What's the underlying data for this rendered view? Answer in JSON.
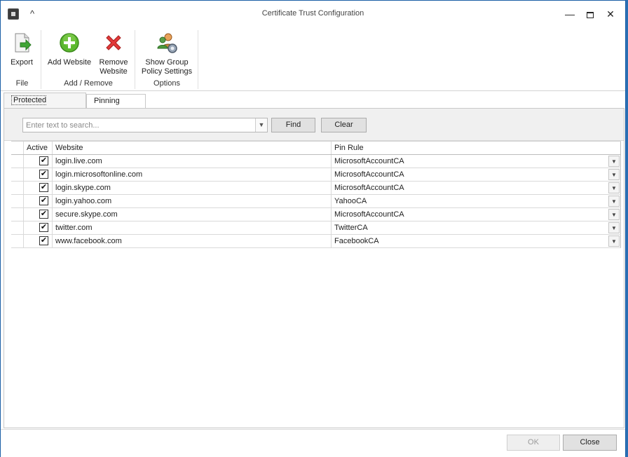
{
  "window": {
    "title": "Certificate Trust Configuration",
    "collapse_glyph": "^",
    "minimize_glyph": "—",
    "close_glyph": "✕"
  },
  "ribbon": {
    "groups": [
      {
        "label": "File",
        "buttons": [
          {
            "label": "Export",
            "icon": "export-icon"
          }
        ]
      },
      {
        "label": "Add / Remove",
        "buttons": [
          {
            "label": "Add Website",
            "icon": "add-icon"
          },
          {
            "label_line1": "Remove",
            "label_line2": "Website",
            "icon": "remove-icon"
          }
        ]
      },
      {
        "label": "Options",
        "buttons": [
          {
            "label_line1": "Show Group",
            "label_line2": "Policy Settings",
            "icon": "group-policy-icon"
          }
        ]
      }
    ]
  },
  "tabs": [
    {
      "label": "Protected Websites",
      "active": true
    },
    {
      "label": "Pinning Rules",
      "active": false
    }
  ],
  "search": {
    "placeholder": "Enter text to search...",
    "value": "",
    "find_label": "Find",
    "clear_label": "Clear"
  },
  "grid": {
    "columns": [
      "Active",
      "Website",
      "Pin Rule"
    ],
    "rows": [
      {
        "active": true,
        "website": "login.live.com",
        "pin_rule": "MicrosoftAccountCA"
      },
      {
        "active": true,
        "website": "login.microsoftonline.com",
        "pin_rule": "MicrosoftAccountCA"
      },
      {
        "active": true,
        "website": "login.skype.com",
        "pin_rule": "MicrosoftAccountCA"
      },
      {
        "active": true,
        "website": "login.yahoo.com",
        "pin_rule": "YahooCA"
      },
      {
        "active": true,
        "website": "secure.skype.com",
        "pin_rule": "MicrosoftAccountCA"
      },
      {
        "active": true,
        "website": "twitter.com",
        "pin_rule": "TwitterCA"
      },
      {
        "active": true,
        "website": "www.facebook.com",
        "pin_rule": "FacebookCA"
      }
    ],
    "check_glyph": "✔"
  },
  "footer": {
    "ok_label": "OK",
    "close_label": "Close"
  },
  "colors": {
    "accent_border": "#1b5fa6",
    "add_green": "#4caf2a",
    "remove_red": "#d93030"
  }
}
